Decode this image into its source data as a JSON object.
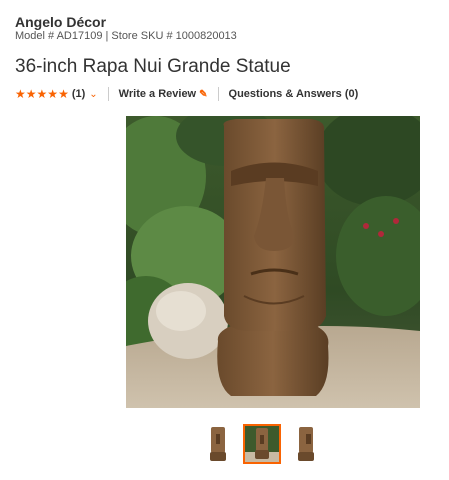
{
  "product": {
    "brand": "Angelo Décor",
    "model_line": "Model # AD17109 | Store SKU # 1000820013",
    "title": "36-inch Rapa Nui Grande Statue"
  },
  "ratings": {
    "stars": 5,
    "count_label": "(1)",
    "write_review_label": "Write a Review",
    "qa_label": "Questions & Answers (0)"
  },
  "gallery": {
    "selected_index": 1,
    "thumbnail_count": 3
  },
  "colors": {
    "accent": "#f96302",
    "text": "#333333"
  },
  "icons": {
    "star": "star-icon",
    "chevron": "chevron-down-icon",
    "pencil": "pencil-icon"
  }
}
